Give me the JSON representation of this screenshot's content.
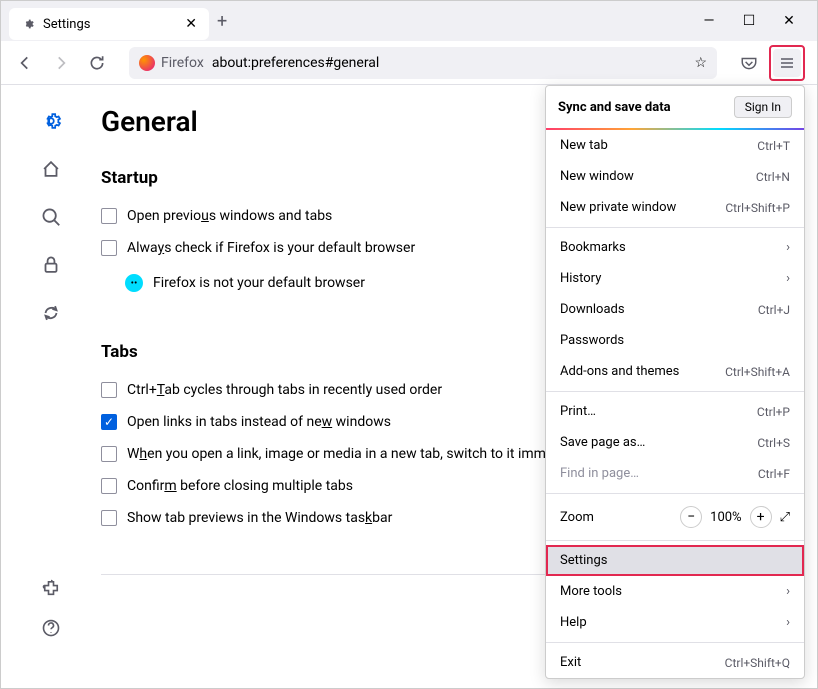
{
  "tab": {
    "title": "Settings"
  },
  "url": {
    "prefix": "Firefox",
    "path": "about:preferences#general"
  },
  "page": {
    "title": "General",
    "startup": {
      "heading": "Startup",
      "previous": "Open previous windows and tabs",
      "default_check": "Always check if Firefox is your default browser",
      "not_default": "Firefox is not your default browser"
    },
    "tabs": {
      "heading": "Tabs",
      "ctrl_tab": "Ctrl+Tab cycles through tabs in recently used order",
      "open_links": "Open links in tabs instead of new windows",
      "switch_immediately": "When you open a link, image or media in a new tab, switch to it immediately",
      "confirm": "Confirm before closing multiple tabs",
      "taskbar": "Show tab previews in the Windows taskbar"
    }
  },
  "menu": {
    "sync": "Sync and save data",
    "signin": "Sign In",
    "newtab": {
      "label": "New tab",
      "shortcut": "Ctrl+T"
    },
    "newwindow": {
      "label": "New window",
      "shortcut": "Ctrl+N"
    },
    "newprivate": {
      "label": "New private window",
      "shortcut": "Ctrl+Shift+P"
    },
    "bookmarks": "Bookmarks",
    "history": "History",
    "downloads": {
      "label": "Downloads",
      "shortcut": "Ctrl+J"
    },
    "passwords": "Passwords",
    "addons": {
      "label": "Add-ons and themes",
      "shortcut": "Ctrl+Shift+A"
    },
    "print": {
      "label": "Print…",
      "shortcut": "Ctrl+P"
    },
    "savepage": {
      "label": "Save page as…",
      "shortcut": "Ctrl+S"
    },
    "findinpage": {
      "label": "Find in page…",
      "shortcut": "Ctrl+F"
    },
    "zoom": {
      "label": "Zoom",
      "value": "100%"
    },
    "settings": "Settings",
    "moretools": "More tools",
    "help": "Help",
    "exit": {
      "label": "Exit",
      "shortcut": "Ctrl+Shift+Q"
    }
  }
}
